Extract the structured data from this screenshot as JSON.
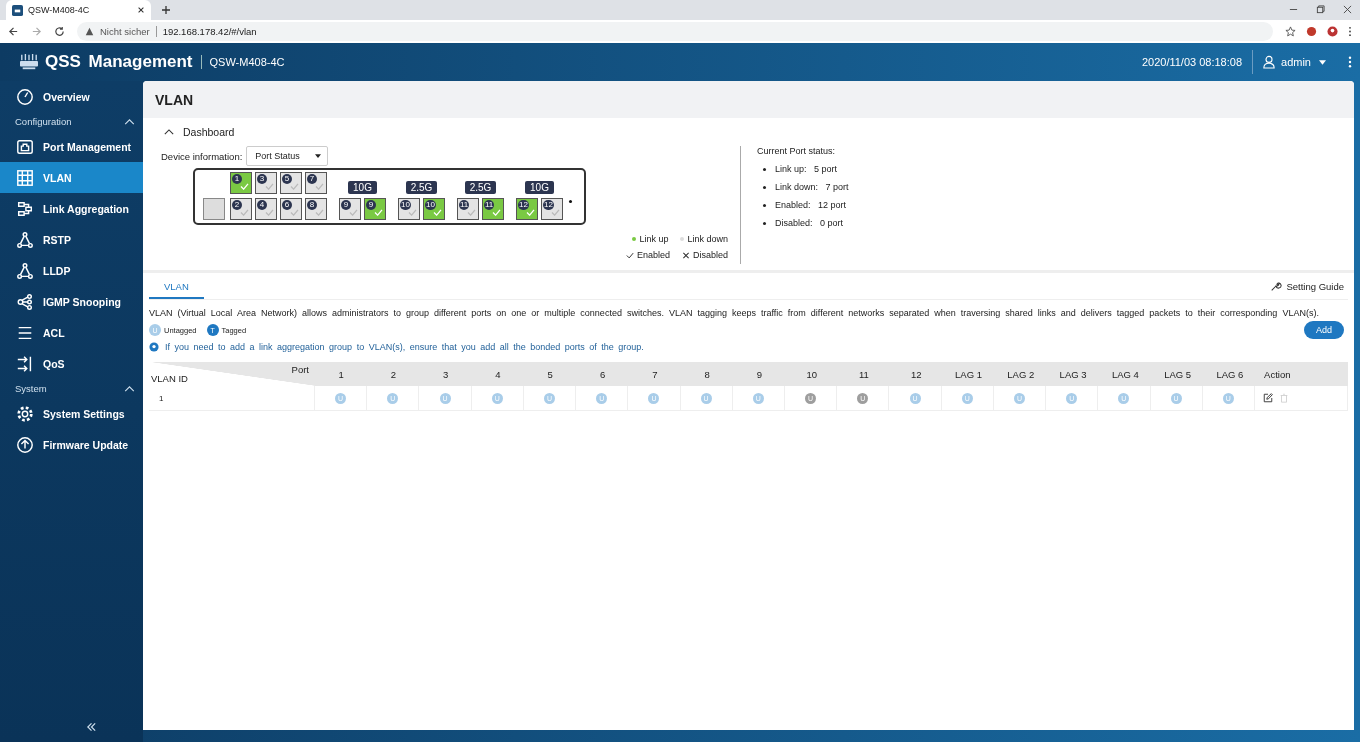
{
  "browser": {
    "tab_title": "QSW-M408-4C",
    "security": "Nicht sicher",
    "url": "192.168.178.42/#/vlan"
  },
  "header": {
    "app_title": "QSS Management",
    "device": "QSW-M408-4C",
    "datetime": "2020/11/03 08:18:08",
    "user": "admin"
  },
  "sidebar": {
    "items": [
      {
        "kind": "item",
        "label": "Overview",
        "selected": false
      },
      {
        "kind": "section",
        "label": "Configuration",
        "expanded": true
      },
      {
        "kind": "item",
        "label": "Port Management",
        "selected": false
      },
      {
        "kind": "item",
        "label": "VLAN",
        "selected": true
      },
      {
        "kind": "item",
        "label": "Link Aggregation",
        "selected": false
      },
      {
        "kind": "item",
        "label": "RSTP",
        "selected": false
      },
      {
        "kind": "item",
        "label": "LLDP",
        "selected": false
      },
      {
        "kind": "item",
        "label": "IGMP Snooping",
        "selected": false
      },
      {
        "kind": "item",
        "label": "ACL",
        "selected": false
      },
      {
        "kind": "item",
        "label": "QoS",
        "selected": false
      },
      {
        "kind": "section",
        "label": "System",
        "expanded": true
      },
      {
        "kind": "item",
        "label": "System Settings",
        "selected": false
      },
      {
        "kind": "item",
        "label": "Firmware Update",
        "selected": false
      }
    ]
  },
  "page_title": "VLAN",
  "dashboard": {
    "title": "Dashboard",
    "expanded": true,
    "device_label": "Device information:",
    "device_select": "Port Status",
    "ports_top": [
      {
        "num": "1",
        "link_up": true
      },
      {
        "num": "3",
        "link_up": false
      },
      {
        "num": "5",
        "link_up": false
      },
      {
        "num": "7",
        "link_up": false
      }
    ],
    "ports_bottom": [
      {
        "num": "2",
        "link_up": false
      },
      {
        "num": "4",
        "link_up": false
      },
      {
        "num": "6",
        "link_up": false
      },
      {
        "num": "8",
        "link_up": false
      }
    ],
    "speed_groups": [
      {
        "label": "10G",
        "ports": [
          {
            "num": "9",
            "link_up": false
          },
          {
            "num": "9",
            "link_up": true
          }
        ]
      },
      {
        "label": "2.5G",
        "ports": [
          {
            "num": "10",
            "link_up": false
          },
          {
            "num": "10",
            "link_up": true
          }
        ]
      },
      {
        "label": "2.5G",
        "ports": [
          {
            "num": "11",
            "link_up": false
          },
          {
            "num": "11",
            "link_up": true
          }
        ]
      },
      {
        "label": "10G",
        "ports": [
          {
            "num": "12",
            "link_up": true
          },
          {
            "num": "12",
            "link_up": false
          }
        ]
      }
    ],
    "legend": [
      "Link up",
      "Link down",
      "Enabled",
      "Disabled"
    ],
    "status_title": "Current Port status:",
    "status": [
      {
        "label": "Link up:",
        "value": "5 port"
      },
      {
        "label": "Link down:",
        "value": "7 port"
      },
      {
        "label": "Enabled:",
        "value": "12 port"
      },
      {
        "label": "Disabled:",
        "value": "0 port"
      }
    ]
  },
  "tabs": [
    {
      "label": "VLAN",
      "selected": true
    }
  ],
  "setting_guide": "Setting Guide",
  "description": "VLAN (Virtual Local Area Network) allows administrators to group different ports on one or multiple connected switches. VLAN tagging keeps traffic from different networks separated when traversing shared links and delivers tagged packets to their corresponding VLAN(s).",
  "badge_legend": [
    {
      "letter": "U",
      "label": "Untagged",
      "color": "#a9cde9"
    },
    {
      "letter": "T",
      "label": "Tagged",
      "color": "#1f78c1"
    }
  ],
  "add_button": "Add",
  "hint": "If you need to add a link aggregation group to VLAN(s), ensure that you add all the bonded ports of the group.",
  "table": {
    "corner_port": "Port",
    "corner_id": "VLAN ID",
    "columns": [
      "1",
      "2",
      "3",
      "4",
      "5",
      "6",
      "7",
      "8",
      "9",
      "10",
      "11",
      "12",
      "LAG 1",
      "LAG 2",
      "LAG 3",
      "LAG 4",
      "LAG 5",
      "LAG 6"
    ],
    "action_column": "Action",
    "rows": [
      {
        "id": "1",
        "cells": [
          {
            "letter": "U",
            "color": "#a9cde9"
          },
          {
            "letter": "U",
            "color": "#a9cde9"
          },
          {
            "letter": "U",
            "color": "#a9cde9"
          },
          {
            "letter": "U",
            "color": "#a9cde9"
          },
          {
            "letter": "U",
            "color": "#a9cde9"
          },
          {
            "letter": "U",
            "color": "#a9cde9"
          },
          {
            "letter": "U",
            "color": "#a9cde9"
          },
          {
            "letter": "U",
            "color": "#a9cde9"
          },
          {
            "letter": "U",
            "color": "#a9cde9"
          },
          {
            "letter": "U",
            "color": "#9e9e9e"
          },
          {
            "letter": "U",
            "color": "#9e9e9e"
          },
          {
            "letter": "U",
            "color": "#a9cde9"
          },
          {
            "letter": "U",
            "color": "#a9cde9"
          },
          {
            "letter": "U",
            "color": "#a9cde9"
          },
          {
            "letter": "U",
            "color": "#a9cde9"
          },
          {
            "letter": "U",
            "color": "#a9cde9"
          },
          {
            "letter": "U",
            "color": "#a9cde9"
          },
          {
            "letter": "U",
            "color": "#a9cde9"
          }
        ]
      }
    ]
  }
}
